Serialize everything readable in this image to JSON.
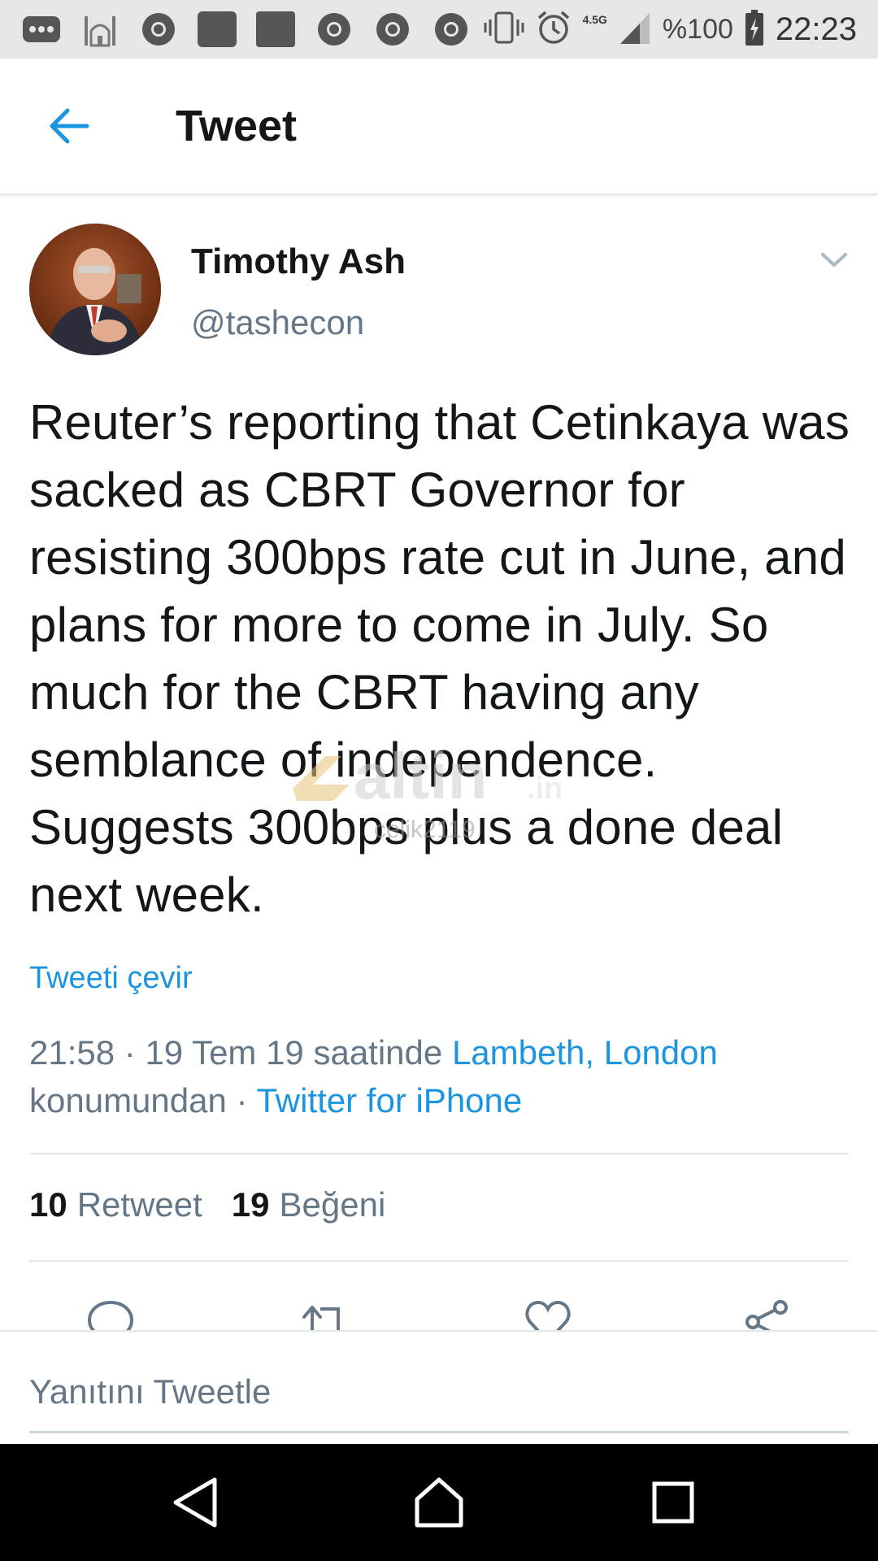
{
  "status_bar": {
    "network": "4.5G",
    "battery": "%100",
    "time": "22:23"
  },
  "header": {
    "title": "Tweet"
  },
  "author": {
    "name": "Timothy Ash",
    "handle": "@tashecon"
  },
  "tweet": {
    "text": "Reuter’s reporting that Cetinkaya was sacked as CBRT Governor for resisting 300bps rate cut in June, and plans for more to come in July. So much for the CBRT having any semblance of independence. Suggests 300bps plus a done deal next week.",
    "translate_label": "Tweeti çevir"
  },
  "watermark": {
    "brand": "altin",
    "suffix": ".in",
    "user": "celik2119"
  },
  "meta": {
    "time": "21:58",
    "date_text": "19 Tem 19 saatinde",
    "location": "Lambeth, London",
    "location_suffix": "konumundan",
    "source": "Twitter for iPhone"
  },
  "stats": {
    "retweet_count": "10",
    "retweet_label": "Retweet",
    "like_count": "19",
    "like_label": "Beğeni"
  },
  "actions": [
    "reply-icon",
    "retweet-icon",
    "like-icon",
    "share-icon"
  ],
  "reply": {
    "placeholder": "Yanıtını Tweetle"
  },
  "colors": {
    "accent": "#1b95e0",
    "secondary_text": "#657786",
    "primary_text": "#14171a"
  }
}
